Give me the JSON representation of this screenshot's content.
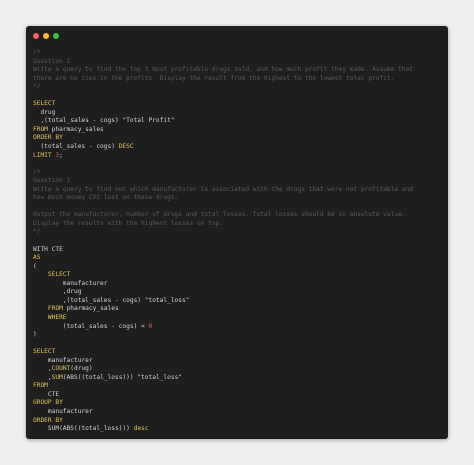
{
  "window": {
    "controls": {
      "close_color": "#ff5f57",
      "minimize_color": "#febc2e",
      "maximize_color": "#28c840"
    }
  },
  "colors": {
    "background": "#eeeeee",
    "editor": "#1e1e1e",
    "keyword": "#e4c55c",
    "comment": "#555a5e",
    "number": "#e0605a",
    "text": "#d4d4d4"
  },
  "code": {
    "lines": [
      [
        {
          "t": "/*",
          "c": "comment"
        }
      ],
      [
        {
          "t": "Question 1",
          "c": "comment"
        }
      ],
      [
        {
          "t": "Write a query to find the top 3 most profitable drugs sold, and how much profit they made. Assume that",
          "c": "comment"
        }
      ],
      [
        {
          "t": "there are no ties in the profits. Display the result from the highest to the lowest total profit.",
          "c": "comment"
        }
      ],
      [
        {
          "t": "*/",
          "c": "comment"
        }
      ],
      [],
      [
        {
          "t": "SELECT",
          "c": "kw"
        }
      ],
      [
        {
          "t": "  drug",
          "c": "ident"
        }
      ],
      [
        {
          "t": "  ,(total_sales - cogs) \"Total Profit\"",
          "c": "ident"
        }
      ],
      [
        {
          "t": "FROM",
          "c": "kw"
        },
        {
          "t": " pharmacy_sales",
          "c": "ident"
        }
      ],
      [
        {
          "t": "ORDER BY",
          "c": "kw"
        }
      ],
      [
        {
          "t": "  (total_sales - cogs) ",
          "c": "ident"
        },
        {
          "t": "DESC",
          "c": "kw"
        }
      ],
      [
        {
          "t": "LIMIT",
          "c": "kw"
        },
        {
          "t": " ",
          "c": "ident"
        },
        {
          "t": "3",
          "c": "num"
        },
        {
          "t": ";",
          "c": "ident"
        }
      ],
      [],
      [
        {
          "t": "/*",
          "c": "comment"
        }
      ],
      [
        {
          "t": "Question 2",
          "c": "comment"
        }
      ],
      [
        {
          "t": "Write a query to find out which manufacturer is associated with the drugs that were not profitable and",
          "c": "comment"
        }
      ],
      [
        {
          "t": "how much money CVS lost on these drugs.",
          "c": "comment"
        }
      ],
      [],
      [
        {
          "t": "Output the manufacturer, number of drugs and total losses. Total losses should be in absolute value.",
          "c": "comment"
        }
      ],
      [
        {
          "t": "Display the results with the highest losses on top.",
          "c": "comment"
        }
      ],
      [
        {
          "t": "*/",
          "c": "comment"
        }
      ],
      [],
      [
        {
          "t": "WITH CTE",
          "c": "ident"
        }
      ],
      [
        {
          "t": "AS",
          "c": "kw"
        }
      ],
      [
        {
          "t": "(",
          "c": "ident"
        }
      ],
      [
        {
          "t": "    ",
          "c": "ident"
        },
        {
          "t": "SELECT",
          "c": "kw"
        }
      ],
      [
        {
          "t": "        manufacturer",
          "c": "ident"
        }
      ],
      [
        {
          "t": "        ,drug",
          "c": "ident"
        }
      ],
      [
        {
          "t": "        ,(total_sales - cogs) \"total_loss\"",
          "c": "ident"
        }
      ],
      [
        {
          "t": "    ",
          "c": "ident"
        },
        {
          "t": "FROM",
          "c": "kw"
        },
        {
          "t": " pharmacy_sales",
          "c": "ident"
        }
      ],
      [
        {
          "t": "    ",
          "c": "ident"
        },
        {
          "t": "WHERE",
          "c": "kw"
        }
      ],
      [
        {
          "t": "        (total_sales - cogs) < ",
          "c": "ident"
        },
        {
          "t": "0",
          "c": "num"
        }
      ],
      [
        {
          "t": ")",
          "c": "ident"
        }
      ],
      [],
      [
        {
          "t": "SELECT",
          "c": "kw"
        }
      ],
      [
        {
          "t": "    manufacturer",
          "c": "ident"
        }
      ],
      [
        {
          "t": "    ,",
          "c": "ident"
        },
        {
          "t": "COUNT",
          "c": "fn"
        },
        {
          "t": "(drug)",
          "c": "ident"
        }
      ],
      [
        {
          "t": "    ,",
          "c": "ident"
        },
        {
          "t": "SUM",
          "c": "fn"
        },
        {
          "t": "(ABS((total_loss))) \"total_loss\"",
          "c": "ident"
        }
      ],
      [
        {
          "t": "FROM",
          "c": "kw"
        }
      ],
      [
        {
          "t": "    CTE",
          "c": "ident"
        }
      ],
      [
        {
          "t": "GROUP BY",
          "c": "kw"
        }
      ],
      [
        {
          "t": "    manufacturer",
          "c": "ident"
        }
      ],
      [
        {
          "t": "ORDER BY",
          "c": "kw"
        }
      ],
      [
        {
          "t": "    SUM(ABS((total_loss))) ",
          "c": "ident"
        },
        {
          "t": "desc",
          "c": "kw"
        }
      ]
    ]
  }
}
